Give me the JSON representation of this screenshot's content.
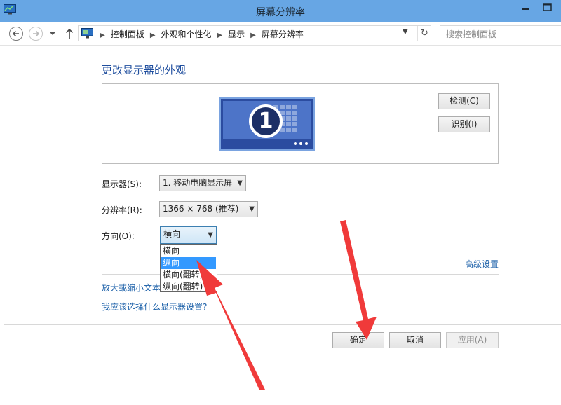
{
  "window": {
    "title": "屏幕分辨率"
  },
  "nav": {
    "breadcrumbs": [
      "控制面板",
      "外观和个性化",
      "显示",
      "屏幕分辨率"
    ],
    "search_placeholder": "搜索控制面板"
  },
  "main": {
    "heading": "更改显示器的外观",
    "preview": {
      "monitor_number": "1",
      "detect_label": "检测(C)",
      "identify_label": "识别(I)"
    },
    "display_label": "显示器(S):",
    "display_value": "1. 移动电脑显示屏",
    "resolution_label": "分辨率(R):",
    "resolution_value": "1366 × 768 (推荐)",
    "orientation_label": "方向(O):",
    "orientation_value": "横向",
    "orientation_options": [
      "横向",
      "纵向",
      "横向(翻转)",
      "纵向(翻转)"
    ],
    "orientation_selected_index": 1,
    "advanced_link": "高级设置",
    "text_size_link": "放大或缩小文本",
    "help_link": "我应该选择什么显示器设置?"
  },
  "footer": {
    "ok_label": "确定",
    "cancel_label": "取消",
    "apply_label": "应用(A)"
  },
  "colors": {
    "titlebar": "#67a6e4",
    "link": "#1a5fa8",
    "selection": "#3399ff",
    "arrow": "#f03a3a"
  }
}
